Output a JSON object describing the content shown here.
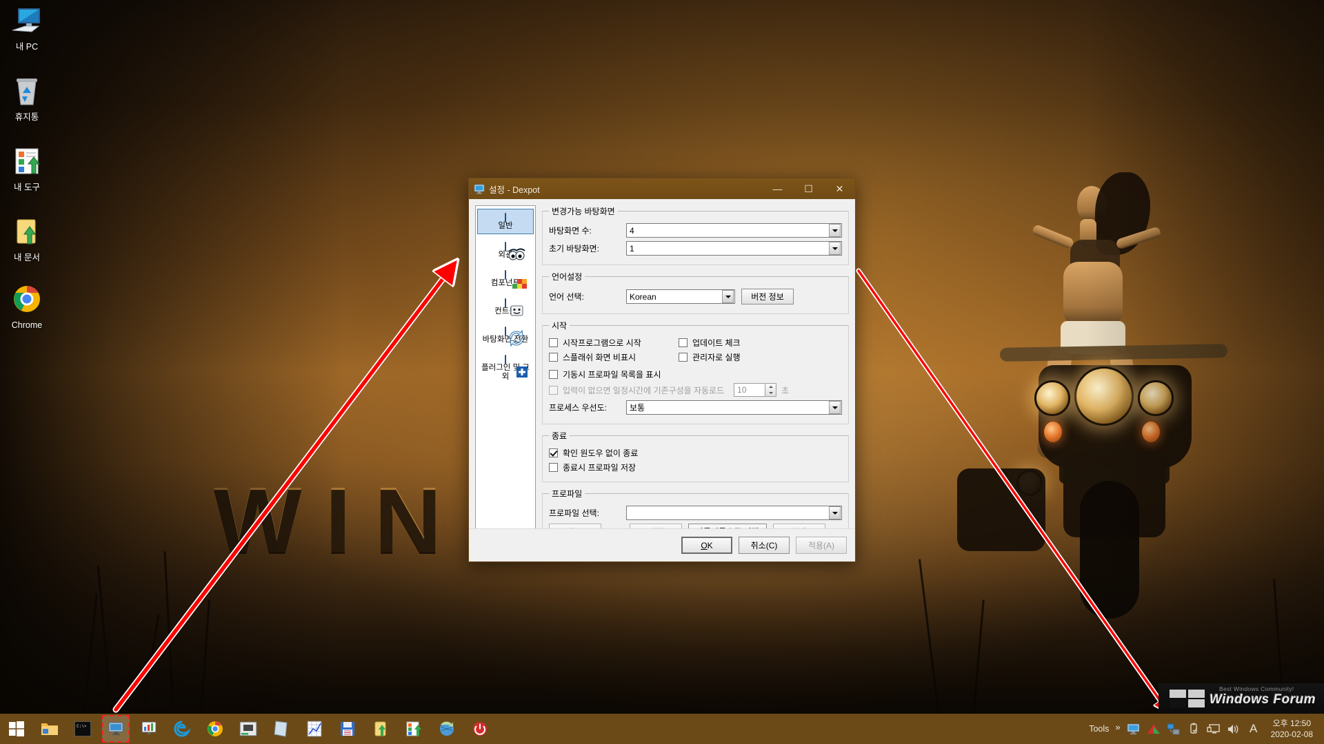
{
  "desktop": {
    "wallpaper_word": "WIND",
    "icons": [
      {
        "label": "내 PC",
        "icon": "computer-icon"
      },
      {
        "label": "휴지통",
        "icon": "recycle-bin-icon"
      },
      {
        "label": "내 도구",
        "icon": "my-tools-icon"
      },
      {
        "label": "내 문서",
        "icon": "my-documents-icon"
      },
      {
        "label": "Chrome",
        "icon": "chrome-icon"
      }
    ]
  },
  "window": {
    "title": "설정 - Dexpot",
    "title_icon": "monitor-icon",
    "minimize": "—",
    "maximize": "☐",
    "close": "✕",
    "sidebar": [
      {
        "label": "일반",
        "icon": "general-icon",
        "selected": true
      },
      {
        "label": "외관",
        "icon": "appearance-eyes-icon",
        "selected": false
      },
      {
        "label": "컴포넌트",
        "icon": "components-blocks-icon",
        "selected": false
      },
      {
        "label": "컨트롤",
        "icon": "controls-face-icon",
        "selected": false
      },
      {
        "label": "바탕화면 전환",
        "icon": "desktop-switch-arrows-icon",
        "selected": false
      },
      {
        "label": "플러그인 및 그 외",
        "icon": "plugins-plus-icon",
        "selected": false
      }
    ],
    "groups": {
      "desktops": {
        "legend": "변경가능 바탕화면",
        "count_label": "바탕화면 수:",
        "count_value": "4",
        "initial_label": "초기 바탕화면:",
        "initial_value": "1"
      },
      "language": {
        "legend": "언어설정",
        "select_label": "언어 선택:",
        "select_value": "Korean",
        "version_button": "버전 정보"
      },
      "startup": {
        "legend": "시작",
        "checkboxes": [
          {
            "label": "시작프로그램으로 시작",
            "checked": false,
            "disabled": false
          },
          {
            "label": "업데이트 체크",
            "checked": false,
            "disabled": false
          },
          {
            "label": "스플래쉬 화면 비표시",
            "checked": false,
            "disabled": false
          },
          {
            "label": "관리자로 실행",
            "checked": false,
            "disabled": false
          },
          {
            "label": "기동시 프로파일 목록을 표시",
            "checked": false,
            "disabled": false
          },
          {
            "label": "입력이 없으면 일정시간에 기존구성을 자동로드",
            "checked": false,
            "disabled": true
          }
        ],
        "autoload_seconds": "10",
        "seconds_unit": "초",
        "priority_label": "프로세스 우선도:",
        "priority_value": "보통"
      },
      "exit": {
        "legend": "종료",
        "checkboxes": [
          {
            "label": "확인 원도우 없이 종료",
            "checked": true,
            "disabled": false
          },
          {
            "label": "종료시 프로파일 저장",
            "checked": false,
            "disabled": false
          }
        ]
      },
      "profile": {
        "legend": "프로파일",
        "select_label": "프로파일 선택:",
        "select_value": "",
        "buttons": [
          {
            "label": "로드",
            "disabled": true
          },
          {
            "label": "저장",
            "disabled": true
          },
          {
            "label": "다른이름으로 저장",
            "disabled": false
          },
          {
            "label": "삭제",
            "disabled": true
          }
        ]
      }
    },
    "footer": {
      "ok": "OK",
      "ok_accel": "O",
      "cancel": "취소(C)",
      "apply": "적용(A)"
    }
  },
  "taskbar": {
    "start_icon": "windows-start-icon",
    "tasks": [
      {
        "icon": "file-explorer-icon",
        "active": false
      },
      {
        "icon": "command-prompt-icon",
        "active": false
      },
      {
        "icon": "dexpot-icon",
        "active": true
      },
      {
        "icon": "chart-monitor-icon",
        "active": false
      },
      {
        "icon": "internet-explorer-icon",
        "active": false
      },
      {
        "icon": "chrome-icon",
        "active": false
      },
      {
        "icon": "hw-monitor-icon",
        "active": false
      },
      {
        "icon": "notepad-icon",
        "active": false
      },
      {
        "icon": "spreadsheet-icon",
        "active": false
      },
      {
        "icon": "floppy-save-icon",
        "active": false
      },
      {
        "icon": "folder-up-icon",
        "active": false
      },
      {
        "icon": "tasklist-up-icon",
        "active": false
      },
      {
        "icon": "globe-refresh-icon",
        "active": false
      },
      {
        "icon": "power-icon",
        "active": false
      }
    ],
    "tray": {
      "tools_label": "Tools",
      "overflow": "»",
      "icons": [
        "monitor-tray-icon",
        "ahnlab-tray-icon",
        "network-tray-icon",
        "usb-eject-icon",
        "display-tray-icon",
        "volume-icon",
        "ime-indicator"
      ],
      "ime_letter": "A"
    },
    "clock": {
      "time": "오후 12:50",
      "date": "2020-02-08"
    }
  },
  "watermark": {
    "sub": "Best Windows Community!",
    "main": "Windows Forum"
  },
  "colors": {
    "titlebar": "#704b15",
    "taskbar": "#6b4a18",
    "selection": "#c5dbf2",
    "annotation": "#ff0000"
  }
}
